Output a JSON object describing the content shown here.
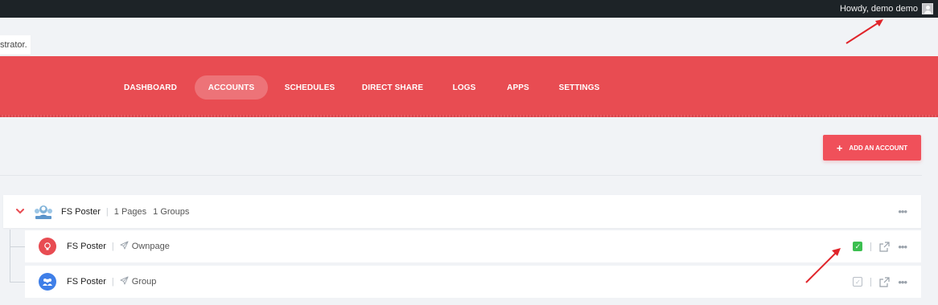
{
  "adminbar": {
    "howdy_text": "Howdy, demo demo"
  },
  "notice": {
    "text": "strator."
  },
  "nav": {
    "items": [
      "DASHBOARD",
      "ACCOUNTS",
      "SCHEDULES",
      "DIRECT SHARE",
      "LOGS",
      "APPS",
      "SETTINGS"
    ],
    "active": "ACCOUNTS",
    "accent_color": "#e84c52"
  },
  "toolbar": {
    "add_account_label": "ADD AN ACCOUNT"
  },
  "accounts": {
    "main": {
      "name": "FS Poster",
      "pages": "1 Pages",
      "groups": "1 Groups"
    },
    "children": [
      {
        "name": "FS Poster",
        "type": "Ownpage",
        "avatar_color": "#e84c52",
        "checked": true
      },
      {
        "name": "FS Poster",
        "type": "Group",
        "avatar_color": "#3f7fe8",
        "checked": false
      }
    ]
  },
  "annotation_color": "#e0242a"
}
